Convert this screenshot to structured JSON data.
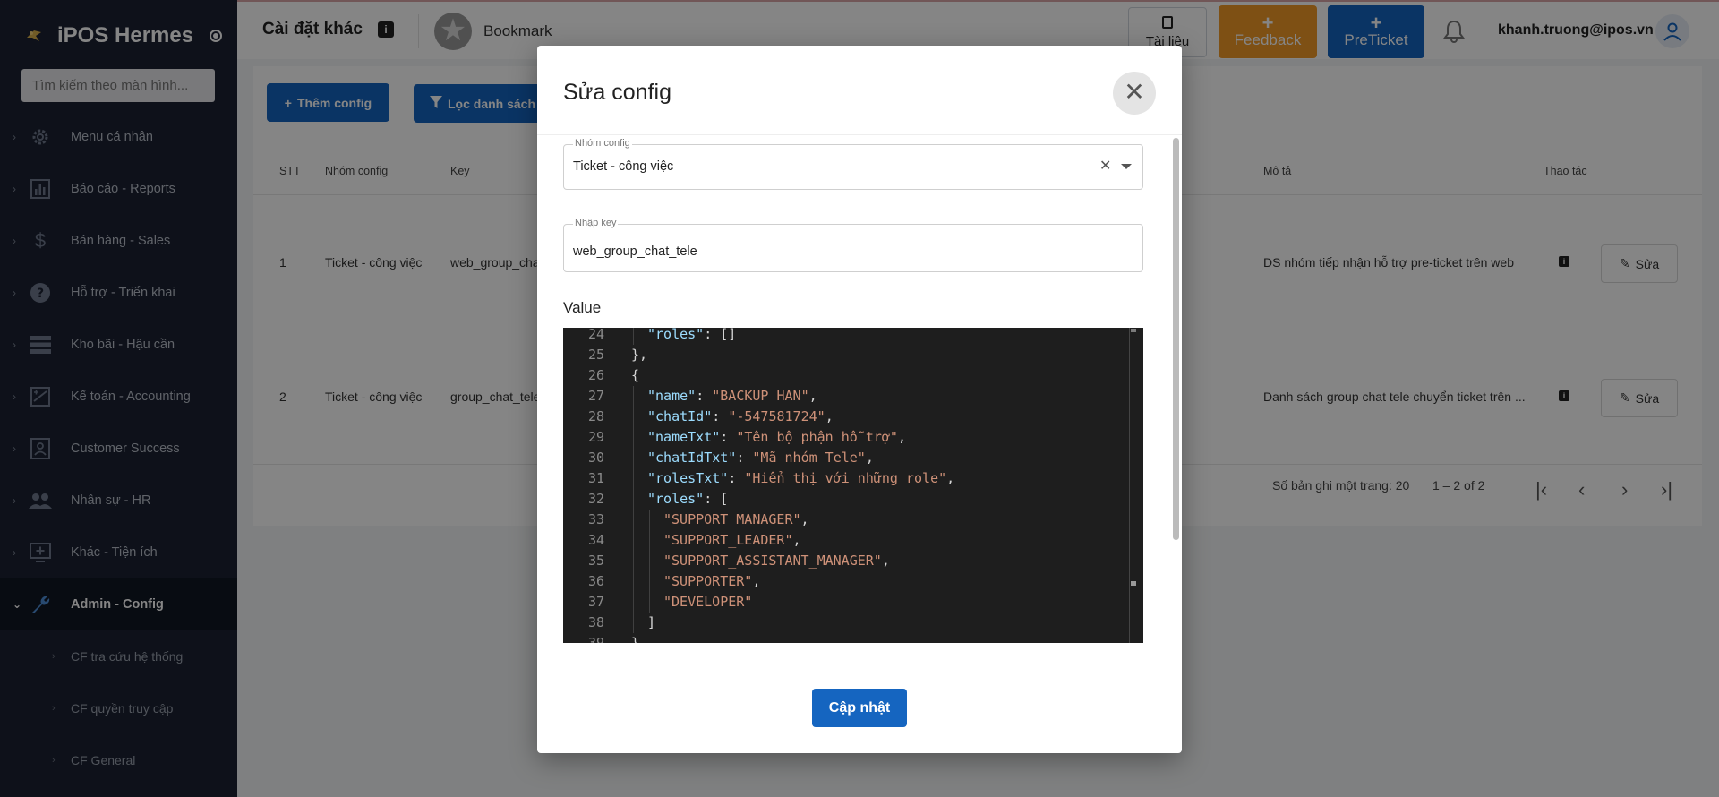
{
  "sidebar": {
    "brand_title": "iPOS Hermes",
    "search_placeholder": "Tìm kiếm theo màn hình...",
    "items": [
      {
        "label": "Menu cá nhân",
        "icon": "gear-icon"
      },
      {
        "label": "Báo cáo - Reports",
        "icon": "chart-icon"
      },
      {
        "label": "Bán hàng - Sales",
        "icon": "dollar-icon"
      },
      {
        "label": "Hỗ trợ - Triển khai",
        "icon": "help-icon"
      },
      {
        "label": "Kho bãi - Hậu cần",
        "icon": "storage-icon"
      },
      {
        "label": "Kế toán - Accounting",
        "icon": "accounting-icon"
      },
      {
        "label": "Customer Success",
        "icon": "badge-icon"
      },
      {
        "label": "Nhân sự - HR",
        "icon": "people-icon"
      },
      {
        "label": "Khác - Tiện ích",
        "icon": "add-box-icon"
      },
      {
        "label": "Admin - Config",
        "icon": "wrench-icon",
        "active": true
      }
    ],
    "subitems": [
      {
        "label": "CF tra cứu hệ thống"
      },
      {
        "label": "CF quyền truy cập"
      },
      {
        "label": "CF General"
      }
    ]
  },
  "header": {
    "page_title": "Cài đặt khác",
    "bookmark_label": "Bookmark",
    "doc_label": "Tài liệu",
    "feedback_label": "Feedback",
    "preticket_label": "PreTicket",
    "user_email": "khanh.truong@ipos.vn",
    "accent_color": "#1565c0",
    "feedback_color": "#f29a27"
  },
  "main": {
    "add_config_label": "Thêm config",
    "filter_label": "Lọc danh sách (Ct",
    "columns": {
      "stt": "STT",
      "group": "Nhóm config",
      "key": "Key",
      "desc": "Mô tả",
      "actions": "Thao tác"
    },
    "rows": [
      {
        "stt": "1",
        "group": "Ticket - công việc",
        "key": "web_group_cha",
        "desc": "DS nhóm tiếp nhận hỗ trợ pre-ticket trên web",
        "edit_label": "Sửa"
      },
      {
        "stt": "2",
        "group": "Ticket - công việc",
        "key": "group_chat_tele",
        "desc": "Danh sách group chat tele chuyển ticket trên ...",
        "edit_label": "Sửa"
      }
    ],
    "pager": {
      "per_page_label": "Số bản ghi một trang: 20",
      "range_label": "1 – 2 of 2"
    }
  },
  "modal": {
    "title": "Sửa config",
    "group_legend": "Nhóm config",
    "group_value": "Ticket - công việc",
    "key_legend": "Nhập key",
    "key_value": "web_group_chat_tele",
    "value_label": "Value",
    "submit_label": "Cập nhật",
    "editor_lines": [
      {
        "n": "24",
        "indent": 2,
        "tokens": [
          {
            "t": "k",
            "v": "\"roles\""
          },
          {
            "t": "p",
            "v": ": []"
          }
        ]
      },
      {
        "n": "25",
        "indent": 1,
        "tokens": [
          {
            "t": "p",
            "v": "},"
          }
        ]
      },
      {
        "n": "26",
        "indent": 1,
        "tokens": [
          {
            "t": "p",
            "v": "{"
          }
        ]
      },
      {
        "n": "27",
        "indent": 2,
        "tokens": [
          {
            "t": "k",
            "v": "\"name\""
          },
          {
            "t": "p",
            "v": ": "
          },
          {
            "t": "s",
            "v": "\"BACKUP HAN\""
          },
          {
            "t": "p",
            "v": ","
          }
        ]
      },
      {
        "n": "28",
        "indent": 2,
        "tokens": [
          {
            "t": "k",
            "v": "\"chatId\""
          },
          {
            "t": "p",
            "v": ": "
          },
          {
            "t": "s",
            "v": "\"-547581724\""
          },
          {
            "t": "p",
            "v": ","
          }
        ]
      },
      {
        "n": "29",
        "indent": 2,
        "tokens": [
          {
            "t": "k",
            "v": "\"nameTxt\""
          },
          {
            "t": "p",
            "v": ": "
          },
          {
            "t": "s",
            "v": "\"Tên bộ phận hỗ trợ\""
          },
          {
            "t": "p",
            "v": ","
          }
        ]
      },
      {
        "n": "30",
        "indent": 2,
        "tokens": [
          {
            "t": "k",
            "v": "\"chatIdTxt\""
          },
          {
            "t": "p",
            "v": ": "
          },
          {
            "t": "s",
            "v": "\"Mã nhóm Tele\""
          },
          {
            "t": "p",
            "v": ","
          }
        ]
      },
      {
        "n": "31",
        "indent": 2,
        "tokens": [
          {
            "t": "k",
            "v": "\"rolesTxt\""
          },
          {
            "t": "p",
            "v": ": "
          },
          {
            "t": "s",
            "v": "\"Hiển thị với những role\""
          },
          {
            "t": "p",
            "v": ","
          }
        ]
      },
      {
        "n": "32",
        "indent": 2,
        "tokens": [
          {
            "t": "k",
            "v": "\"roles\""
          },
          {
            "t": "p",
            "v": ": ["
          }
        ]
      },
      {
        "n": "33",
        "indent": 3,
        "tokens": [
          {
            "t": "s",
            "v": "\"SUPPORT_MANAGER\""
          },
          {
            "t": "p",
            "v": ","
          }
        ]
      },
      {
        "n": "34",
        "indent": 3,
        "tokens": [
          {
            "t": "s",
            "v": "\"SUPPORT_LEADER\""
          },
          {
            "t": "p",
            "v": ","
          }
        ]
      },
      {
        "n": "35",
        "indent": 3,
        "tokens": [
          {
            "t": "s",
            "v": "\"SUPPORT_ASSISTANT_MANAGER\""
          },
          {
            "t": "p",
            "v": ","
          }
        ]
      },
      {
        "n": "36",
        "indent": 3,
        "tokens": [
          {
            "t": "s",
            "v": "\"SUPPORTER\""
          },
          {
            "t": "p",
            "v": ","
          }
        ]
      },
      {
        "n": "37",
        "indent": 3,
        "tokens": [
          {
            "t": "s",
            "v": "\"DEVELOPER\""
          }
        ]
      },
      {
        "n": "38",
        "indent": 2,
        "tokens": [
          {
            "t": "p",
            "v": "]"
          }
        ]
      },
      {
        "n": "39",
        "indent": 1,
        "tokens": [
          {
            "t": "p",
            "v": "},"
          }
        ]
      }
    ]
  }
}
